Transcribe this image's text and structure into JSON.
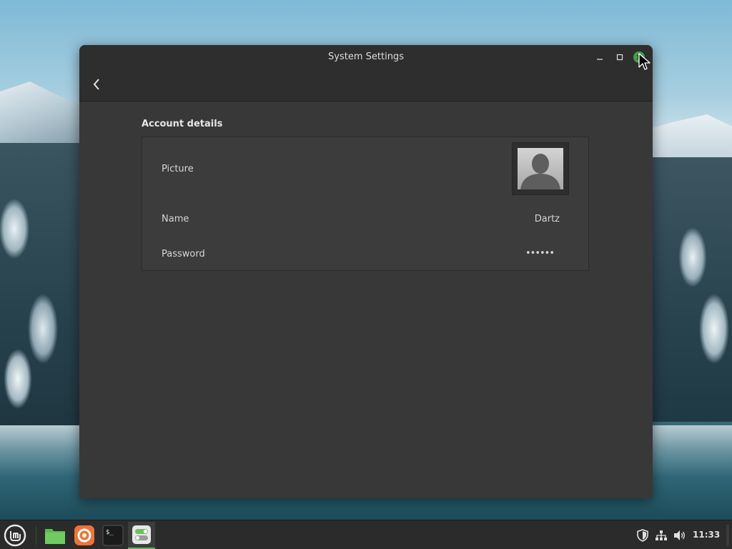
{
  "window": {
    "title": "System Settings"
  },
  "account": {
    "section_title": "Account details",
    "rows": [
      {
        "label": "Picture"
      },
      {
        "label": "Name",
        "value": "Dartz"
      },
      {
        "label": "Password",
        "value": "••••••"
      }
    ]
  },
  "taskbar": {
    "clock": "11:33",
    "apps": [
      "menu-icon",
      "files-icon",
      "firefox-icon",
      "terminal-icon",
      "settings-icon"
    ]
  },
  "colors": {
    "accent": "#45a046",
    "window_bg": "#383838",
    "titlebar_bg": "#2e2e2e",
    "taskbar_bg": "#2b2b2b"
  }
}
